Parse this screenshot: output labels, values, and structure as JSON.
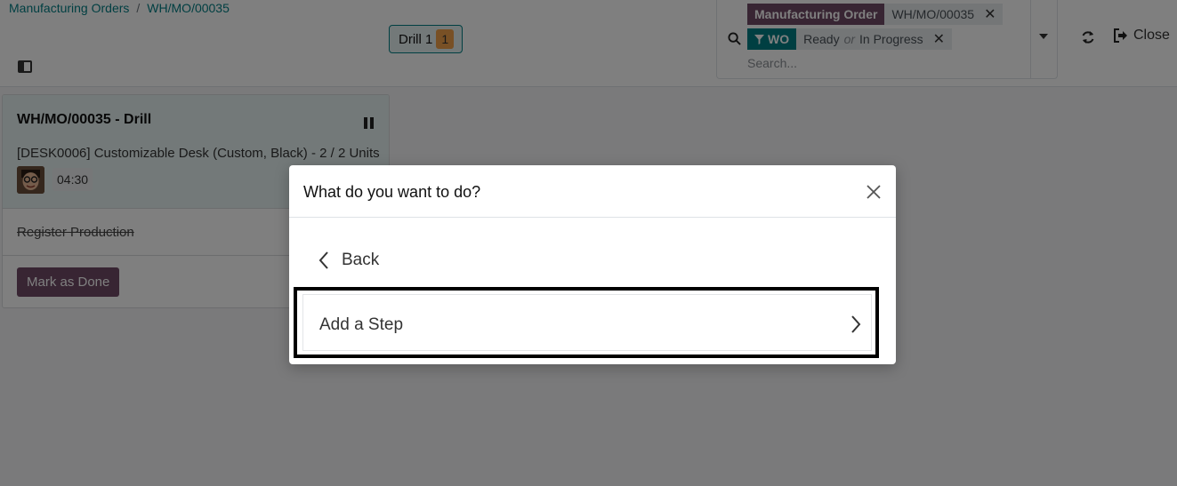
{
  "breadcrumb": {
    "parent": "Manufacturing Orders",
    "separator": "/",
    "current": "WH/MO/00035"
  },
  "workcenter": {
    "name": "Drill 1",
    "count": "1"
  },
  "search": {
    "facet_mo_label": "Manufacturing Order",
    "facet_mo_value": "WH/MO/00035",
    "facet_wo_label": "WO",
    "facet_wo_value_1": "Ready",
    "facet_wo_or": "or",
    "facet_wo_value_2": "In Progress",
    "remove_glyph": "✕",
    "placeholder": "Search..."
  },
  "toolbar": {
    "close_label": "Close"
  },
  "card": {
    "title": "WH/MO/00035 - Drill",
    "product": "[DESK0006] Customizable Desk (Custom, Black) - 2 / 2 Units",
    "timer": "04:30",
    "step_label": "Register Production",
    "done_label": "Mark as Done"
  },
  "modal": {
    "title": "What do you want to do?",
    "back_label": "Back",
    "option_label": "Add a Step"
  },
  "colors": {
    "accent_teal": "#017e84",
    "brand_purple": "#714b67",
    "facet_mo_bg": "#714b67",
    "facet_wo_bg": "#017e84",
    "badge_orange": "#f0a14a"
  },
  "icons": [
    "search-icon",
    "filter-icon",
    "refresh-icon",
    "sign-out-icon",
    "pause-icon",
    "close-icon",
    "chevron-left-icon",
    "chevron-right-icon",
    "panel-toggle-icon",
    "caret-down-icon"
  ]
}
